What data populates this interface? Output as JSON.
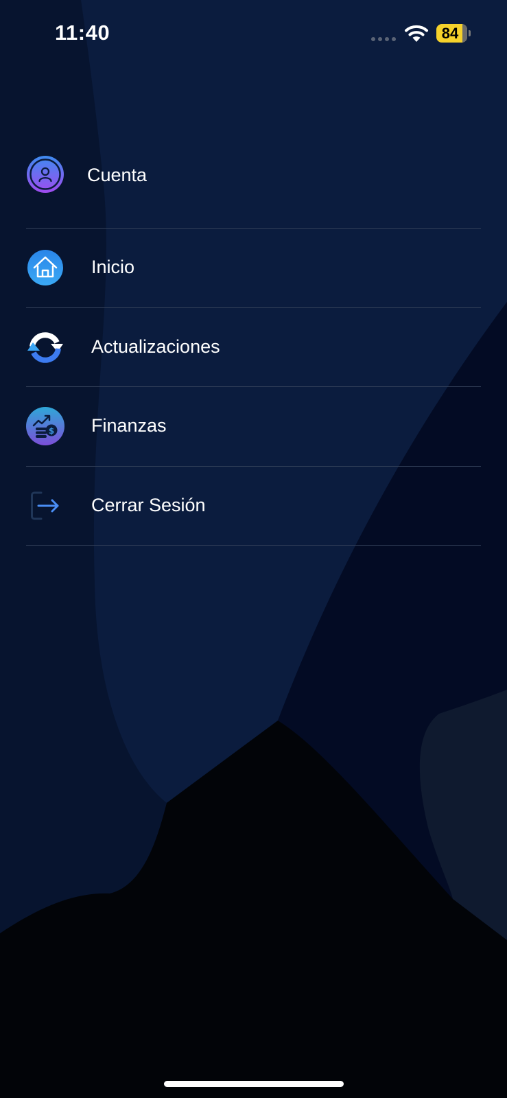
{
  "status_bar": {
    "time": "11:40",
    "battery_level": "84",
    "battery_color": "#f6d22b"
  },
  "menu": {
    "items": [
      {
        "id": "cuenta",
        "label": "Cuenta",
        "icon": "user-icon"
      },
      {
        "id": "inicio",
        "label": "Inicio",
        "icon": "home-icon"
      },
      {
        "id": "actualizaciones",
        "label": "Actualizaciones",
        "icon": "refresh-icon"
      },
      {
        "id": "finanzas",
        "label": "Finanzas",
        "icon": "finance-icon"
      },
      {
        "id": "cerrar-sesion",
        "label": "Cerrar Sesión",
        "icon": "logout-icon"
      }
    ]
  },
  "colors": {
    "background": "#07142f",
    "panel": "#0b1c3e",
    "divider": "#34415a",
    "accent_blue": "#3d8bf0",
    "accent_purple": "#a04cf0"
  }
}
